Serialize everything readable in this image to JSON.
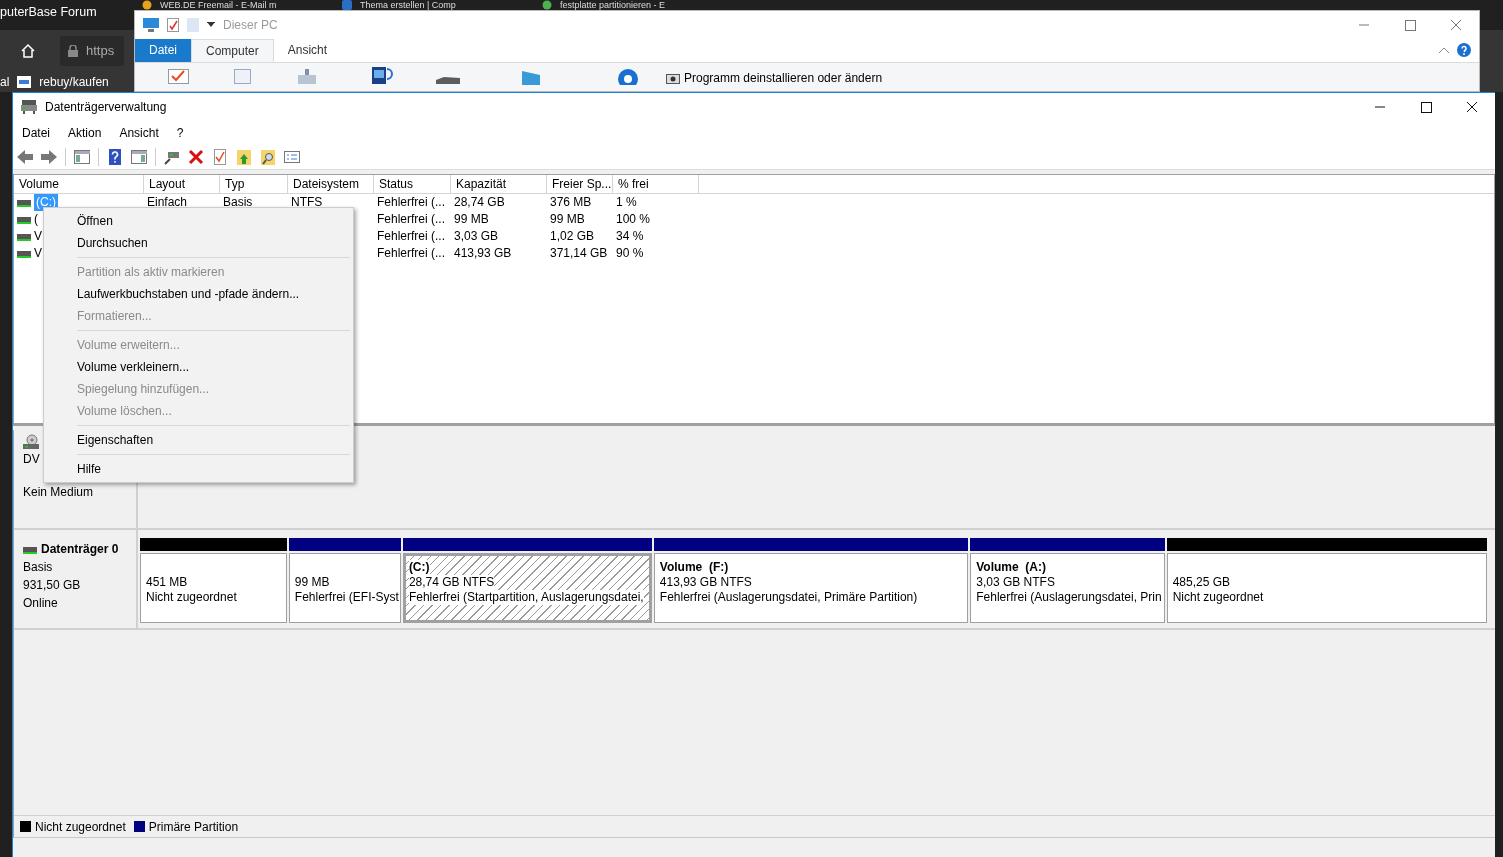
{
  "browser": {
    "tab_title": "puterBase Forum",
    "tabs": [
      {
        "title": "WEB.DE Freemail - E-Mail m"
      },
      {
        "title": "Thema erstellen | Comp"
      },
      {
        "title": "festplatte partitionieren - E"
      }
    ],
    "address": "https",
    "bookmarks": [
      "al",
      "rebuy/kaufen"
    ]
  },
  "explorer": {
    "title": "Dieser PC",
    "ribbon_tabs": [
      {
        "label": "Datei",
        "kind": "file",
        "selected": false
      },
      {
        "label": "Computer",
        "kind": "tab",
        "selected": true
      },
      {
        "label": "Ansicht",
        "kind": "tab",
        "selected": false
      }
    ],
    "ribbon_command": "Programm deinstallieren oder ändern"
  },
  "window": {
    "title": "Datenträgerverwaltung"
  },
  "menu": [
    "Datei",
    "Aktion",
    "Ansicht",
    "?"
  ],
  "volume_table": {
    "columns": [
      "Volume",
      "Layout",
      "Typ",
      "Dateisystem",
      "Status",
      "Kapazität",
      "Freier Sp...",
      "% frei"
    ],
    "rows": [
      {
        "selected": true,
        "volume": "(C:)",
        "layout": "Einfach",
        "type": "Basis",
        "filesystem": "NTFS",
        "status": "Fehlerfrei (...",
        "capacity": "28,74 GB",
        "free": "376 MB",
        "percent_free": "1 %"
      },
      {
        "selected": false,
        "volume": "(",
        "status": "Fehlerfrei (...",
        "capacity": "99 MB",
        "free": "99 MB",
        "percent_free": "100 %"
      },
      {
        "selected": false,
        "volume": "V",
        "status": "Fehlerfrei (...",
        "capacity": "3,03 GB",
        "free": "1,02 GB",
        "percent_free": "34 %"
      },
      {
        "selected": false,
        "volume": "V",
        "status": "Fehlerfrei (...",
        "capacity": "413,93 GB",
        "free": "371,14 GB",
        "percent_free": "90 %"
      }
    ]
  },
  "context_menu": [
    {
      "kind": "item",
      "label": "Öffnen",
      "disabled": false
    },
    {
      "kind": "item",
      "label": "Durchsuchen",
      "disabled": false
    },
    {
      "kind": "separator"
    },
    {
      "kind": "item",
      "label": "Partition als aktiv markieren",
      "disabled": true
    },
    {
      "kind": "item",
      "label": "Laufwerkbuchstaben und -pfade ändern...",
      "disabled": false
    },
    {
      "kind": "item",
      "label": "Formatieren...",
      "disabled": true
    },
    {
      "kind": "separator"
    },
    {
      "kind": "item",
      "label": "Volume erweitern...",
      "disabled": true
    },
    {
      "kind": "item",
      "label": "Volume verkleinern...",
      "disabled": false
    },
    {
      "kind": "item",
      "label": "Spiegelung hinzufügen...",
      "disabled": true
    },
    {
      "kind": "item",
      "label": "Volume löschen...",
      "disabled": true
    },
    {
      "kind": "separator"
    },
    {
      "kind": "item",
      "label": "Eigenschaften",
      "disabled": false
    },
    {
      "kind": "separator"
    },
    {
      "kind": "item",
      "label": "Hilfe",
      "disabled": false
    }
  ],
  "disks": [
    {
      "kind": "dvd",
      "name": "DV",
      "status": "Kein Medium"
    },
    {
      "kind": "disk",
      "name": "Datenträger 0",
      "type": "Basis",
      "size": "931,50 GB",
      "state": "Online",
      "partitions": [
        {
          "kind": "unallocated",
          "selected": false,
          "size": "451 MB",
          "status": "Nicht zugeordnet"
        },
        {
          "kind": "primary",
          "selected": false,
          "size": "99 MB",
          "status": "Fehlerfrei (EFI-Syst"
        },
        {
          "kind": "primary",
          "selected": true,
          "name": "(C:)",
          "size": "28,74 GB NTFS",
          "status": "Fehlerfrei (Startpartition, Auslagerungsdatei,"
        },
        {
          "kind": "primary",
          "selected": false,
          "name": "Volume  (F:)",
          "size": "413,93 GB NTFS",
          "status": "Fehlerfrei (Auslagerungsdatei, Primäre Partition)"
        },
        {
          "kind": "primary",
          "selected": false,
          "name": "Volume  (A:)",
          "size": "3,03 GB NTFS",
          "status": "Fehlerfrei (Auslagerungsdatei, Prin"
        },
        {
          "kind": "unallocated",
          "selected": false,
          "size": "485,25 GB",
          "status": "Nicht zugeordnet"
        }
      ]
    }
  ],
  "legend": [
    {
      "label": "Nicht zugeordnet",
      "color": "#000000"
    },
    {
      "label": "Primäre Partition",
      "color": "#000080"
    }
  ]
}
